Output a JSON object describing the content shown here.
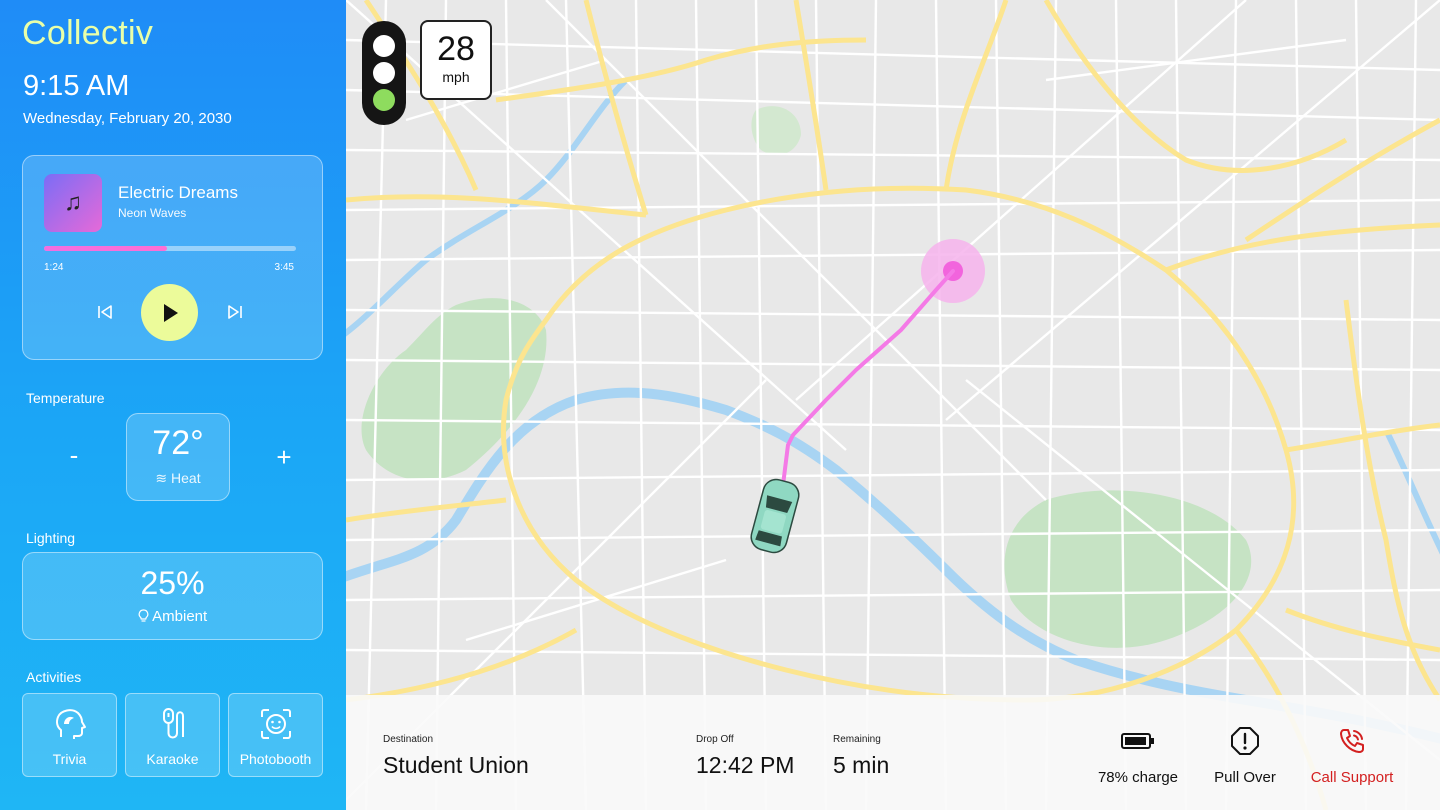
{
  "app": {
    "name": "Collectiv"
  },
  "status": {
    "time": "9:15 AM",
    "date": "Wednesday, February 20, 2030"
  },
  "music": {
    "title": "Electric Dreams",
    "artist": "Neon Waves",
    "elapsed": "1:24",
    "total": "3:45",
    "progress": 0.49,
    "album_icon": "music-note-icon"
  },
  "temperature": {
    "label": "Temperature",
    "value": "72°",
    "mode": "≋ Heat",
    "minus": "-",
    "plus": "+"
  },
  "lighting": {
    "label": "Lighting",
    "value": "25%",
    "mode": "Ambient",
    "mode_icon": "bulb-icon"
  },
  "activities": {
    "label": "Activities",
    "items": [
      {
        "label": "Trivia",
        "icon": "trivia-icon"
      },
      {
        "label": "Karaoke",
        "icon": "microphone-icon"
      },
      {
        "label": "Photobooth",
        "icon": "face-scan-icon"
      }
    ]
  },
  "traffic_light": {
    "active": "green"
  },
  "speed": {
    "value": "28",
    "unit": "mph"
  },
  "trip": {
    "destination_label": "Destination",
    "destination": "Student Union",
    "dropoff_label": "Drop Off",
    "dropoff": "12:42 PM",
    "remaining_label": "Remaining",
    "remaining": "5 min"
  },
  "actions": {
    "charge": "78% charge",
    "pull_over": "Pull Over",
    "call_support": "Call Support"
  },
  "colors": {
    "accent": "#e9ffa8",
    "route": "#f47ae6",
    "car": "#8fd8c2",
    "support": "#d32020",
    "road_major": "#fde68a",
    "water": "#a8d5f5",
    "park": "#c5e5c5"
  }
}
